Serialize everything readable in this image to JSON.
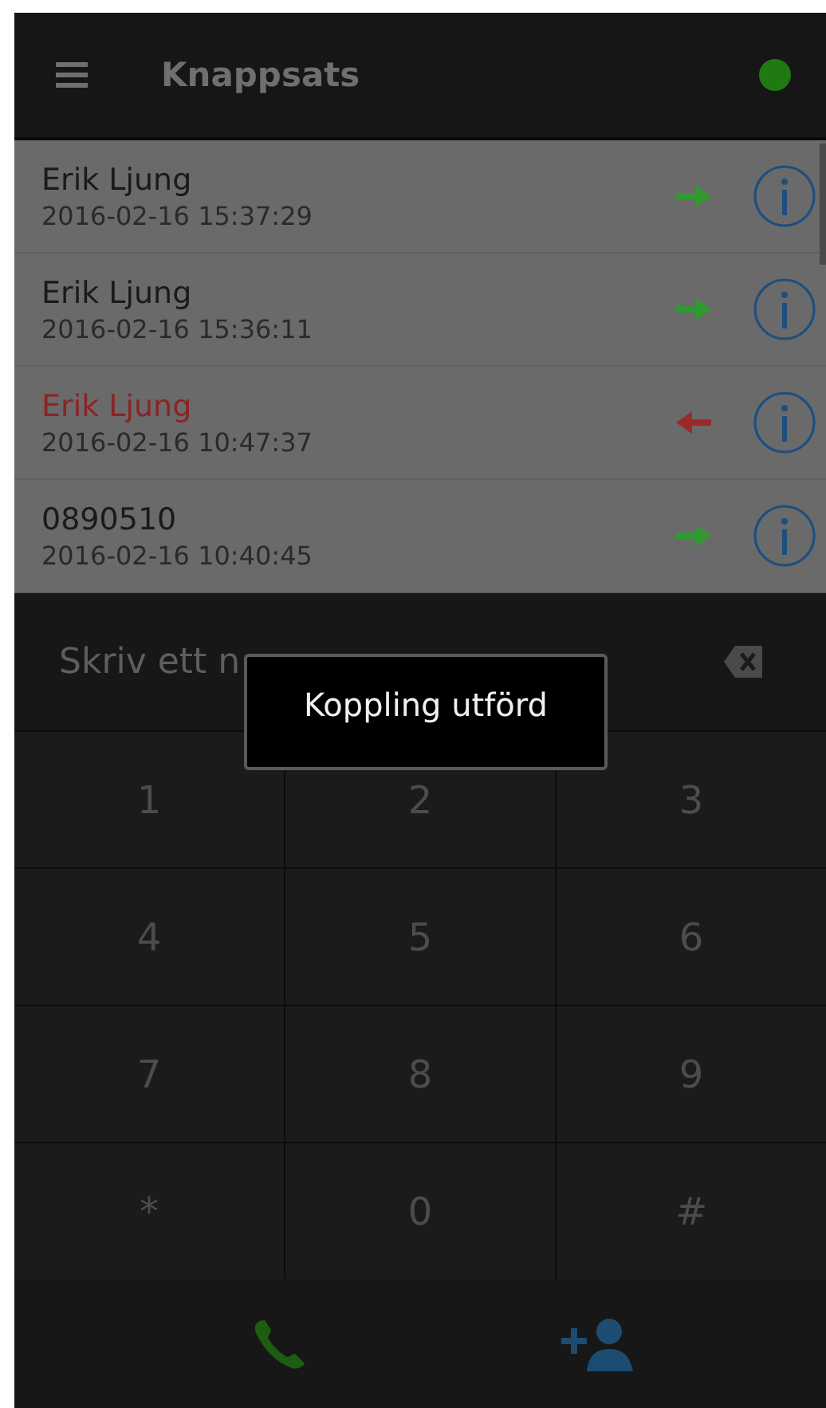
{
  "header": {
    "title": "Knappsats",
    "connected": true
  },
  "calls": [
    {
      "name": "Erik Ljung",
      "time": "2016-02-16 15:37:29",
      "missed": false
    },
    {
      "name": "Erik Ljung",
      "time": "2016-02-16 15:36:11",
      "missed": false
    },
    {
      "name": "Erik Ljung",
      "time": "2016-02-16 10:47:37",
      "missed": true
    },
    {
      "name": "0890510",
      "time": "2016-02-16 10:40:45",
      "missed": false
    }
  ],
  "number_field": {
    "placeholder": "Skriv ett n"
  },
  "keypad": [
    "1",
    "2",
    "3",
    "4",
    "5",
    "6",
    "7",
    "8",
    "9",
    "*",
    "0",
    "#"
  ],
  "toast": "Koppling utförd"
}
